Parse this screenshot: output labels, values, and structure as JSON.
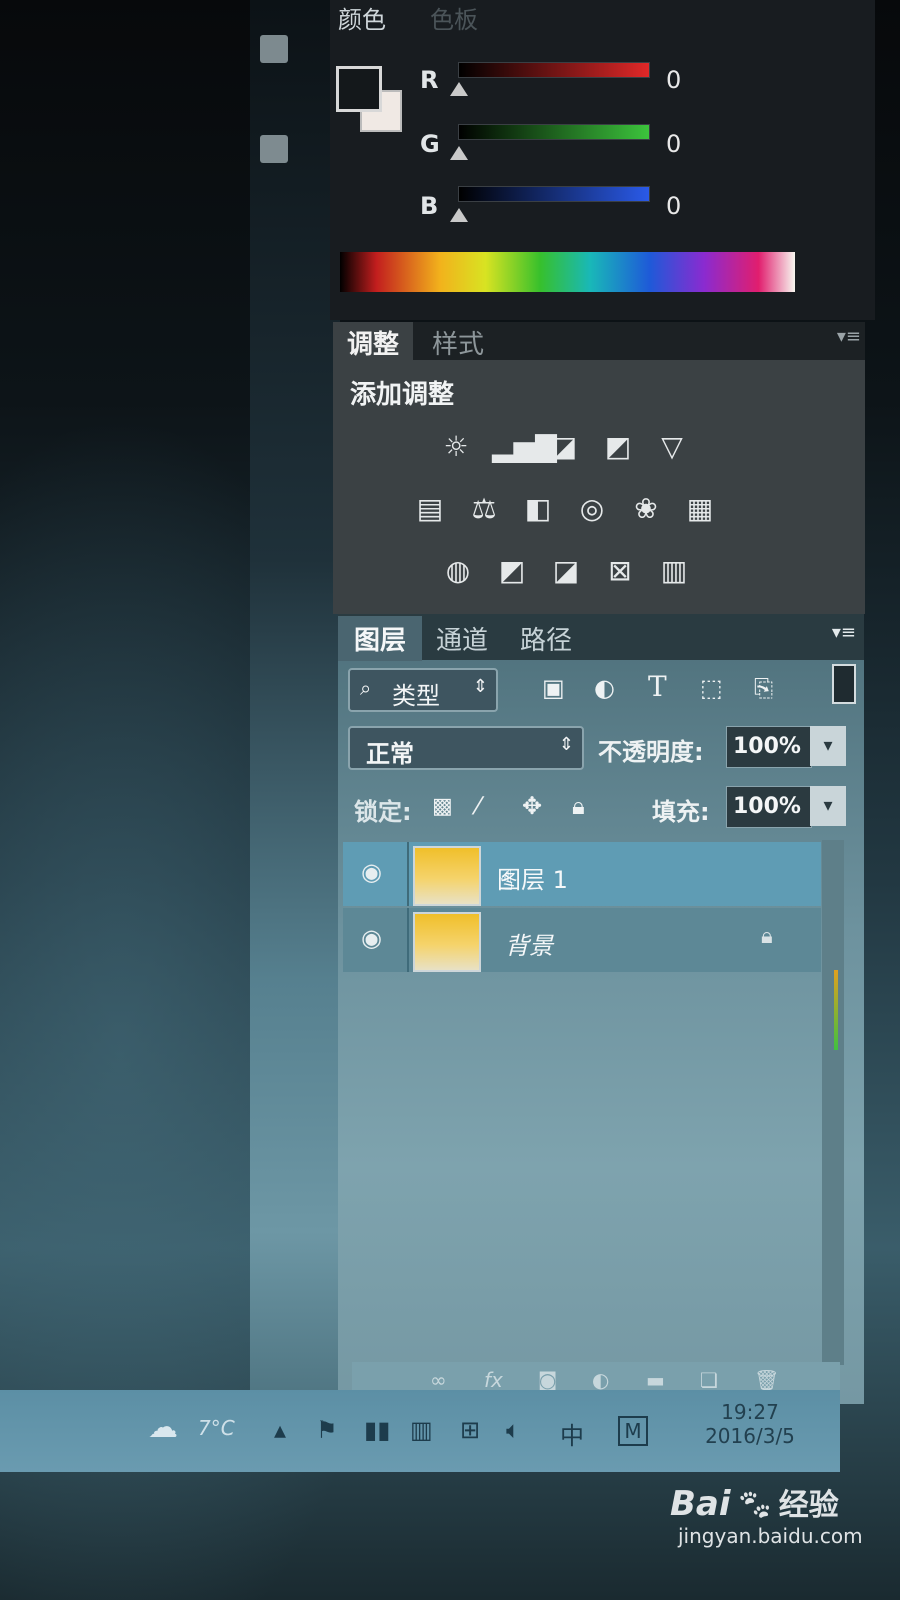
{
  "toolbar_strip": {
    "icons": [
      "history-icon",
      "3d-icon"
    ]
  },
  "color_panel": {
    "tabs": [
      "颜色",
      "色板"
    ],
    "channels": [
      {
        "label": "R",
        "value": "0",
        "color": "#e02828"
      },
      {
        "label": "G",
        "value": "0",
        "color": "#3cc43c"
      },
      {
        "label": "B",
        "value": "0",
        "color": "#2a5ae8"
      }
    ]
  },
  "adjust_panel": {
    "tabs": [
      "调整",
      "样式"
    ],
    "heading": "添加调整",
    "icon_rows": [
      [
        "brightness-icon",
        "levels-icon",
        "curves-icon",
        "exposure-icon",
        "vibrance-icon"
      ],
      [
        "hue-saturation-icon",
        "color-balance-icon",
        "black-white-icon",
        "photo-filter-icon",
        "channel-mixer-icon",
        "color-lookup-icon"
      ],
      [
        "invert-icon",
        "posterize-icon",
        "threshold-icon",
        "selective-color-icon",
        "gradient-map-icon"
      ]
    ]
  },
  "layers_panel": {
    "tabs": [
      "图层",
      "通道",
      "路径"
    ],
    "filter_label": "类型",
    "filter_icons": [
      "image-filter-icon",
      "adjustment-filter-icon",
      "type-filter-icon",
      "shape-filter-icon",
      "smart-object-filter-icon"
    ],
    "blend_mode": "正常",
    "opacity_label": "不透明度:",
    "opacity_value": "100%",
    "lock_label": "锁定:",
    "fill_label": "填充:",
    "fill_value": "100%",
    "layers": [
      {
        "name": "图层 1",
        "selected": true
      },
      {
        "name": "背景",
        "selected": false
      }
    ],
    "footer_icons": [
      "link-icon",
      "fx-icon",
      "mask-icon",
      "adjustment-icon",
      "folder-icon",
      "new-layer-icon",
      "trash-icon"
    ]
  },
  "taskbar": {
    "weather": "7°C",
    "ime": "中",
    "time": "19:27",
    "date": "2016/3/5"
  },
  "watermark": {
    "brand": "Bai",
    "brand_suffix": "经验",
    "url": "jingyan.baidu.com"
  }
}
